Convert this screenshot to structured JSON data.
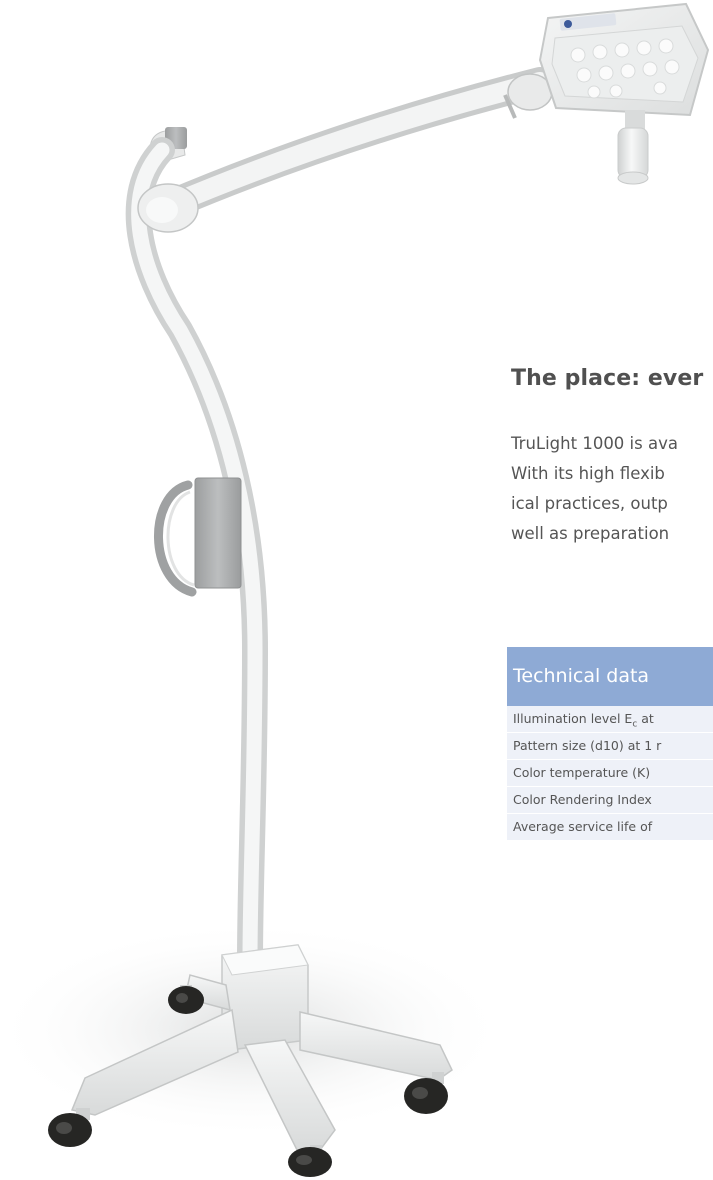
{
  "section": {
    "heading": "The place: ever",
    "paragraph_lines": [
      "TruLight 1000 is ava",
      "With its high flexib",
      "ical practices, outp",
      "well as preparation"
    ]
  },
  "technical_data": {
    "title": "Technical data",
    "rows": [
      {
        "label_prefix": "Illumination level E",
        "label_sub": "c",
        "label_suffix": " at"
      },
      {
        "label": "Pattern size (d10) at 1 r"
      },
      {
        "label": "Color temperature (K)"
      },
      {
        "label": "Color Rendering Index"
      },
      {
        "label": "Average service life of"
      }
    ]
  },
  "colors": {
    "table_header_bg": "#8eaad5",
    "row_tint": "#eef1f8",
    "lamp_body": "#f2f3f3",
    "grip_gray": "#a7a9aa",
    "wheel_black": "#262624"
  }
}
